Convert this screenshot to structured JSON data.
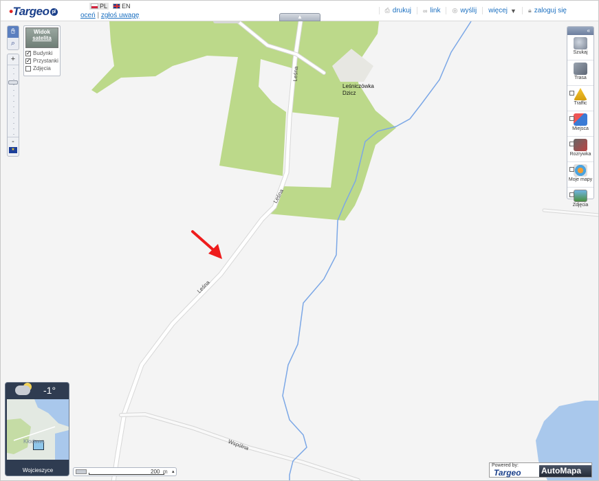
{
  "header": {
    "logo_text": "Targeo",
    "logo_badge": "pl",
    "languages": [
      {
        "code": "PL",
        "active": true
      },
      {
        "code": "EN",
        "active": false
      }
    ],
    "rate_link": "oceń",
    "separator": "|",
    "report_link": "zgłoś uwagę",
    "collapse_icon": "▲"
  },
  "toolbar": {
    "items": [
      {
        "label": "drukuj",
        "icon": "print-icon"
      },
      {
        "label": "link",
        "icon": "link-icon"
      },
      {
        "label": "wyślij",
        "icon": "send-icon"
      },
      {
        "label": "więcej",
        "icon": "chevron-down-icon"
      },
      {
        "label": "zaloguj się",
        "icon": "lock-icon"
      }
    ]
  },
  "map_controls": {
    "zoom_in": "+",
    "zoom_out": "-",
    "satellite_button": [
      "Widok",
      "satelita"
    ],
    "layers": [
      {
        "label": "Budynki",
        "checked": true
      },
      {
        "label": "Przystanki",
        "checked": true
      },
      {
        "label": "Zdjęcia",
        "checked": false
      }
    ]
  },
  "right_panel": {
    "collapse_label": "«",
    "items": [
      {
        "label": "Szukaj",
        "checkbox": false
      },
      {
        "label": "Trasa",
        "checkbox": false
      },
      {
        "label": "Traffic",
        "checkbox": true
      },
      {
        "label": "Miejsca",
        "checkbox": true
      },
      {
        "label": "Rozrywka",
        "checkbox": true
      },
      {
        "label": "Moje mapy",
        "checkbox": true
      },
      {
        "label": "Zdjęcia",
        "checkbox": true
      }
    ]
  },
  "map_labels": {
    "road_lesna": "Leśna",
    "road_wspolna": "Wspólna",
    "place_line1": "Leśniczówka",
    "place_line2": "Dzicz"
  },
  "weather": {
    "temperature": "-1°",
    "map_city": "Kłodawa",
    "location": "Wojcieszyce"
  },
  "scale": {
    "value": "200",
    "unit": "m"
  },
  "powered_by": {
    "label": "Powered by:",
    "brand": "Targeo",
    "partner": "AutoMapa"
  },
  "colors": {
    "forest": "#bcd98a",
    "water": "#a9c8ec",
    "river": "#7ba7e6",
    "road": "#ffffff",
    "arrow": "#ee1c1c"
  }
}
